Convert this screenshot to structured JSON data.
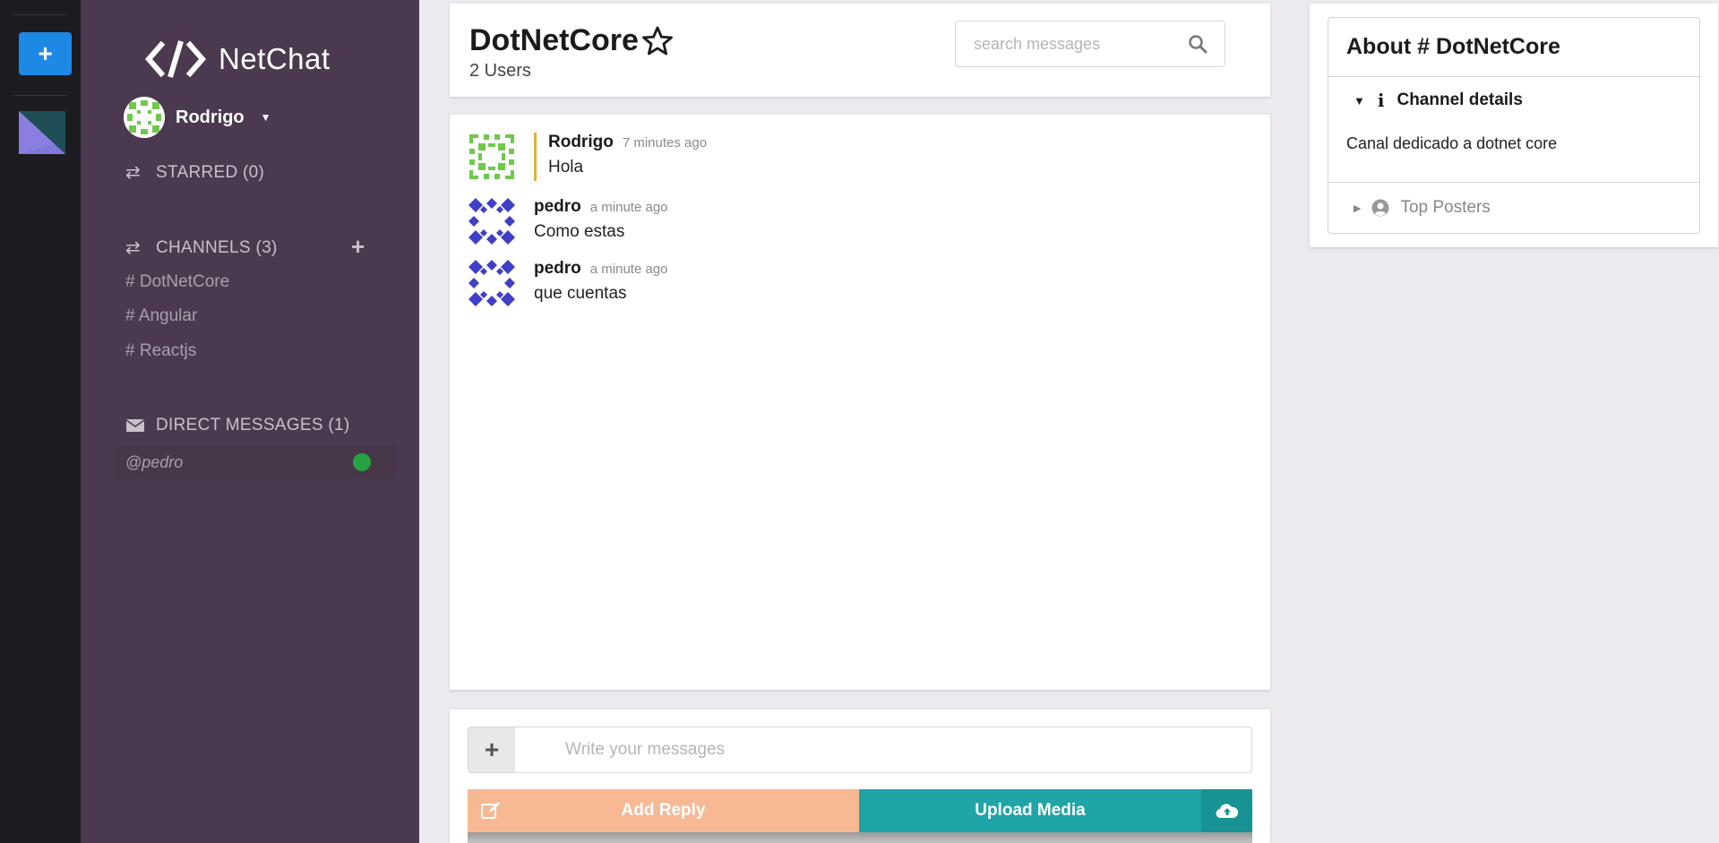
{
  "app": {
    "name": "NetChat",
    "add_button": "+"
  },
  "sidebar": {
    "user": {
      "name": "Rodrigo"
    },
    "starred": {
      "label": "STARRED (0)"
    },
    "channels": {
      "label": "CHANNELS (3)",
      "items": [
        "# DotNetCore",
        "# Angular",
        "# Reactjs"
      ]
    },
    "direct_messages": {
      "label": "DIRECT MESSAGES (1)",
      "items": [
        {
          "name": "@pedro",
          "status": "online",
          "status_color": "#27a243"
        }
      ]
    }
  },
  "header": {
    "channel_name": "DotNetCore",
    "user_count": "2 Users",
    "search_placeholder": "search messages"
  },
  "messages": [
    {
      "author": "Rodrigo",
      "time": "7 minutes ago",
      "text": "Hola",
      "own": true
    },
    {
      "author": "pedro",
      "time": "a minute ago",
      "text": "Como estas",
      "own": false
    },
    {
      "author": "pedro",
      "time": "a minute ago",
      "text": "que cuentas",
      "own": false
    }
  ],
  "composer": {
    "placeholder": "Write your messages",
    "plus": "+",
    "reply_label": "Add Reply",
    "upload_label": "Upload Media"
  },
  "about": {
    "title": "About # DotNetCore",
    "details_label": "Channel details",
    "description": "Canal dedicado a dotnet core",
    "top_posters_label": "Top Posters"
  },
  "colors": {
    "rail": "#1c1b20",
    "sidebar": "#4b3a4f",
    "accent_blue": "#1e88e5",
    "reply": "#f7b994",
    "upload": "#1fa5a8",
    "own_message_bar": "#e2b13c",
    "online": "#27a243"
  },
  "icons": {
    "brand": "code-icon",
    "star": "star-outline-icon",
    "search": "search-icon",
    "starred_section": "exchange-icon",
    "channels_section": "exchange-icon",
    "dm_section": "envelope-icon",
    "edit": "edit-icon",
    "upload": "cloud-upload-icon",
    "info": "info-icon",
    "top_posters": "user-circle-icon"
  }
}
